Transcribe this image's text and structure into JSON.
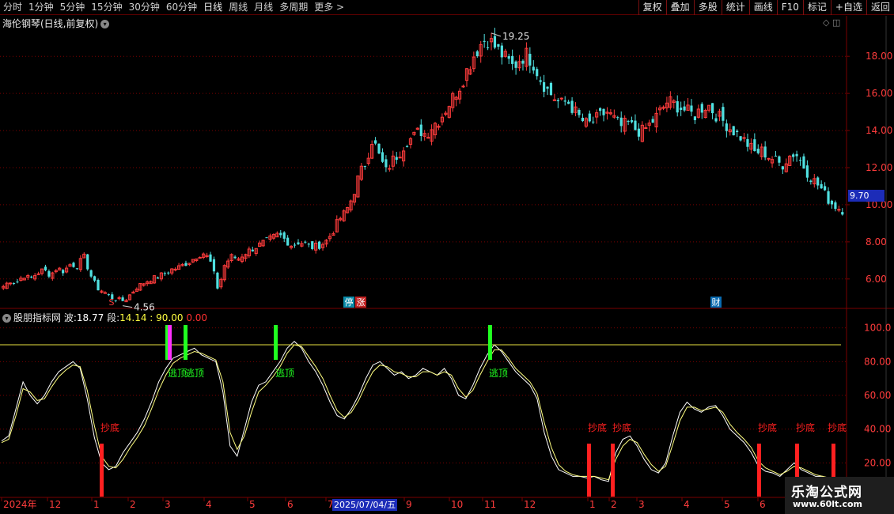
{
  "toolbar": {
    "periods": [
      "分时",
      "1分钟",
      "5分钟",
      "15分钟",
      "30分钟",
      "60分钟",
      "日线",
      "周线",
      "月线",
      "多周期",
      "更多 >"
    ],
    "active_period": "日线",
    "tools": [
      "复权",
      "叠加",
      "多股",
      "统计",
      "画线",
      "F10",
      "标记",
      "+自选",
      "返回"
    ]
  },
  "chart_title": "海伦钢琴(日线,前复权)",
  "indicator": {
    "name": "股朋指标网",
    "bo_label": "波:",
    "bo_value": "18.77",
    "duan_label": "段:",
    "duan_value": "14.14 : 90.00",
    "extra_value": "0.00"
  },
  "price_tag": "9.70",
  "date_tag": "2025/07/04/五",
  "watermark": {
    "line1": "乐淘公式网",
    "line2": "www.60lt.com"
  },
  "chart_data": [
    {
      "type": "candlestick",
      "title": "海伦钢琴(日线,前复权)",
      "ylim": [
        4.5,
        19.5
      ],
      "y_ticks": [
        "18.00",
        "16.00",
        "14.00",
        "12.00",
        "10.00",
        "8.00",
        "6.00"
      ],
      "annotations": {
        "high": "19.25",
        "low": "4.56",
        "last": "9.70"
      },
      "markers": [
        "S",
        "停",
        "涨",
        "财"
      ],
      "close_path": [
        5.6,
        5.9,
        5.8,
        6.2,
        6.0,
        6.3,
        6.5,
        6.2,
        6.6,
        6.4,
        6.8,
        6.7,
        7.2,
        6.2,
        5.5,
        5.3,
        5.0,
        4.9,
        4.8,
        5.2,
        5.6,
        5.8,
        6.0,
        6.1,
        6.3,
        6.5,
        6.6,
        6.8,
        7.0,
        7.3,
        7.4,
        6.8,
        5.4,
        6.8,
        7.2,
        7.1,
        7.4,
        7.6,
        7.8,
        8.0,
        8.2,
        8.4,
        8.1,
        7.8,
        8.0,
        7.9,
        7.7,
        7.8,
        8.0,
        8.5,
        9.2,
        9.6,
        10.4,
        11.6,
        12.3,
        13.6,
        12.6,
        11.8,
        12.4,
        12.8,
        13.4,
        13.6,
        14.0,
        13.8,
        14.3,
        14.6,
        15.2,
        15.8,
        16.4,
        17.2,
        18.0,
        18.6,
        19.0,
        18.6,
        18.2,
        17.8,
        17.4,
        17.9,
        18.1,
        17.6,
        16.8,
        16.2,
        15.8,
        15.4,
        15.6,
        15.1,
        14.6,
        14.3,
        14.5,
        14.8,
        15.0,
        14.6,
        14.2,
        14.4,
        14.1,
        13.9,
        14.2,
        14.6,
        15.1,
        15.6,
        15.4,
        15.2,
        15.0,
        14.8,
        15.2,
        15.4,
        14.9,
        14.6,
        14.2,
        13.9,
        13.6,
        13.2,
        12.8,
        12.9,
        12.6,
        12.4,
        12.1,
        12.6,
        12.8,
        12.2,
        11.6,
        11.2,
        10.8,
        10.2,
        9.9,
        9.7
      ]
    },
    {
      "type": "line",
      "title": "股朋指标网",
      "ylim": [
        0,
        105
      ],
      "y_ticks": [
        "100.0",
        "80.00",
        "60.00",
        "40.00",
        "20.00"
      ],
      "x_tick_labels": [
        "2024年",
        "12",
        "1",
        "2",
        "3",
        "4",
        "5",
        "6",
        "7",
        "2025/07/04/五",
        "9",
        "10",
        "11",
        "12",
        "1",
        "2",
        "3",
        "4",
        "5",
        "6"
      ],
      "threshold": 90,
      "series": [
        {
          "values": [
            33,
            36,
            52,
            68,
            60,
            55,
            60,
            68,
            74,
            77,
            80,
            76,
            58,
            35,
            20,
            16,
            18,
            26,
            32,
            38,
            46,
            56,
            68,
            76,
            82,
            84,
            86,
            88,
            84,
            82,
            80,
            62,
            30,
            24,
            40,
            56,
            66,
            68,
            74,
            80,
            88,
            92,
            88,
            80,
            74,
            66,
            56,
            48,
            46,
            52,
            60,
            70,
            78,
            80,
            76,
            72,
            74,
            70,
            72,
            76,
            74,
            72,
            76,
            70,
            60,
            58,
            66,
            76,
            84,
            90,
            86,
            80,
            74,
            70,
            66,
            58,
            38,
            24,
            16,
            14,
            12,
            12,
            11,
            12,
            10,
            9,
            26,
            34,
            36,
            30,
            22,
            16,
            14,
            20,
            36,
            50,
            56,
            52,
            50,
            53,
            54,
            48,
            40,
            36,
            32,
            26,
            18,
            15,
            14,
            12,
            16,
            20,
            16,
            14,
            12,
            12,
            10,
            11,
            10
          ]
        },
        {
          "values": [
            32,
            34,
            48,
            64,
            62,
            57,
            58,
            65,
            71,
            75,
            78,
            77,
            63,
            42,
            24,
            18,
            17,
            22,
            29,
            35,
            42,
            52,
            63,
            72,
            79,
            82,
            84,
            86,
            85,
            83,
            81,
            68,
            38,
            28,
            36,
            50,
            62,
            66,
            71,
            77,
            85,
            90,
            89,
            83,
            77,
            70,
            60,
            51,
            47,
            50,
            57,
            66,
            74,
            78,
            77,
            74,
            73,
            71,
            71,
            74,
            74,
            72,
            74,
            72,
            64,
            59,
            63,
            72,
            80,
            87,
            87,
            82,
            76,
            72,
            68,
            61,
            44,
            29,
            19,
            15,
            13,
            12,
            12,
            12,
            11,
            10,
            22,
            30,
            34,
            32,
            25,
            19,
            15,
            18,
            31,
            45,
            53,
            53,
            51,
            52,
            53,
            50,
            43,
            38,
            34,
            29,
            21,
            17,
            15,
            13,
            15,
            18,
            17,
            15,
            13,
            12,
            11,
            11,
            10
          ]
        }
      ],
      "signals_top": [
        "逃顶",
        "逃顶",
        "逃顶",
        "逃顶"
      ],
      "signals_bottom": [
        "抄底",
        "抄底",
        "抄底",
        "抄底",
        "抄底",
        "抄底"
      ]
    }
  ],
  "colors": {
    "up": "#ff3c3c",
    "down": "#50e0e0",
    "grid": "#7a0000",
    "signal_top": "#20ff20",
    "signal_bottom": "#ff2020",
    "kdj_line": "#ffff80"
  }
}
